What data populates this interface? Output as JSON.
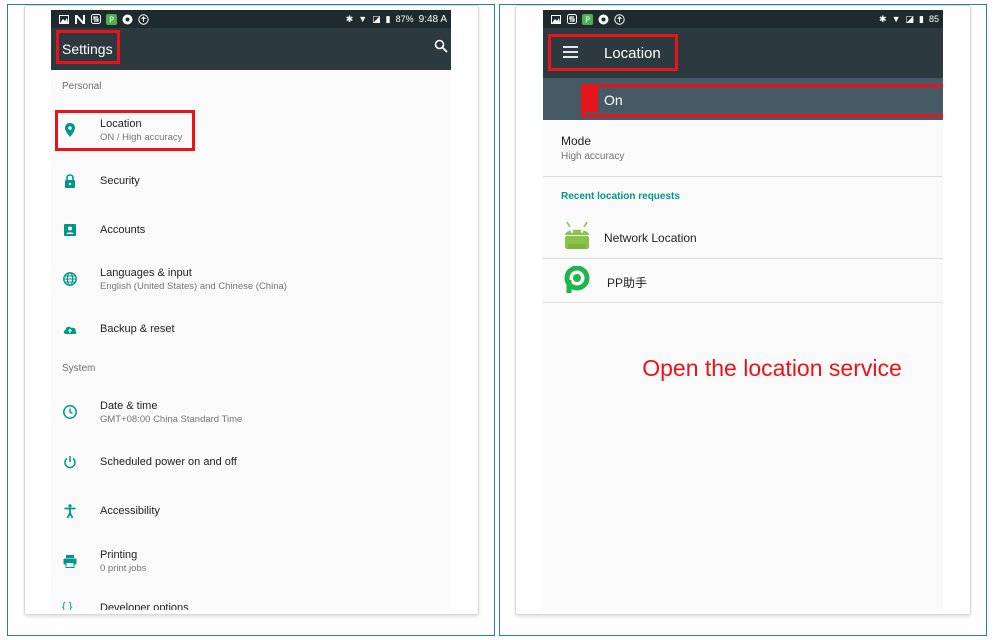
{
  "colors": {
    "accent": "#009688",
    "red": "#e8141b",
    "appbar": "#2c3a40",
    "statusbar": "#1f2a2e",
    "frame": "#2f7ba8"
  },
  "left": {
    "status": {
      "battery": "87%",
      "time": "9:48 A"
    },
    "title": "Settings",
    "search_icon": "search-icon",
    "personal_header": "Personal",
    "items": [
      {
        "icon": "location-pin-icon",
        "title": "Location",
        "subtitle": "ON / High accuracy"
      },
      {
        "icon": "lock-icon",
        "title": "Security",
        "subtitle": ""
      },
      {
        "icon": "account-icon",
        "title": "Accounts",
        "subtitle": ""
      },
      {
        "icon": "globe-icon",
        "title": "Languages & input",
        "subtitle": "English (United States) and Chinese (China)"
      },
      {
        "icon": "cloud-upload-icon",
        "title": "Backup & reset",
        "subtitle": ""
      }
    ],
    "system_header": "System",
    "system_items": [
      {
        "icon": "clock-icon",
        "title": "Date & time",
        "subtitle": "GMT+08:00 China Standard Time"
      },
      {
        "icon": "power-icon",
        "title": "Scheduled power on and off",
        "subtitle": ""
      },
      {
        "icon": "accessibility-icon",
        "title": "Accessibility",
        "subtitle": ""
      },
      {
        "icon": "printer-icon",
        "title": "Printing",
        "subtitle": "0 print jobs"
      },
      {
        "icon": "developer-icon",
        "title": "Developer options",
        "subtitle": ""
      }
    ]
  },
  "right": {
    "status": {
      "battery": "85"
    },
    "title": "Location",
    "menu_icon": "menu-icon",
    "toggle_label": "On",
    "mode_title": "Mode",
    "mode_value": "High accuracy",
    "recent_header": "Recent location requests",
    "requests": [
      {
        "icon": "android-icon",
        "label": "Network Location"
      },
      {
        "icon": "pp-icon",
        "label": "PP助手"
      }
    ],
    "caption": "Open the location service"
  }
}
